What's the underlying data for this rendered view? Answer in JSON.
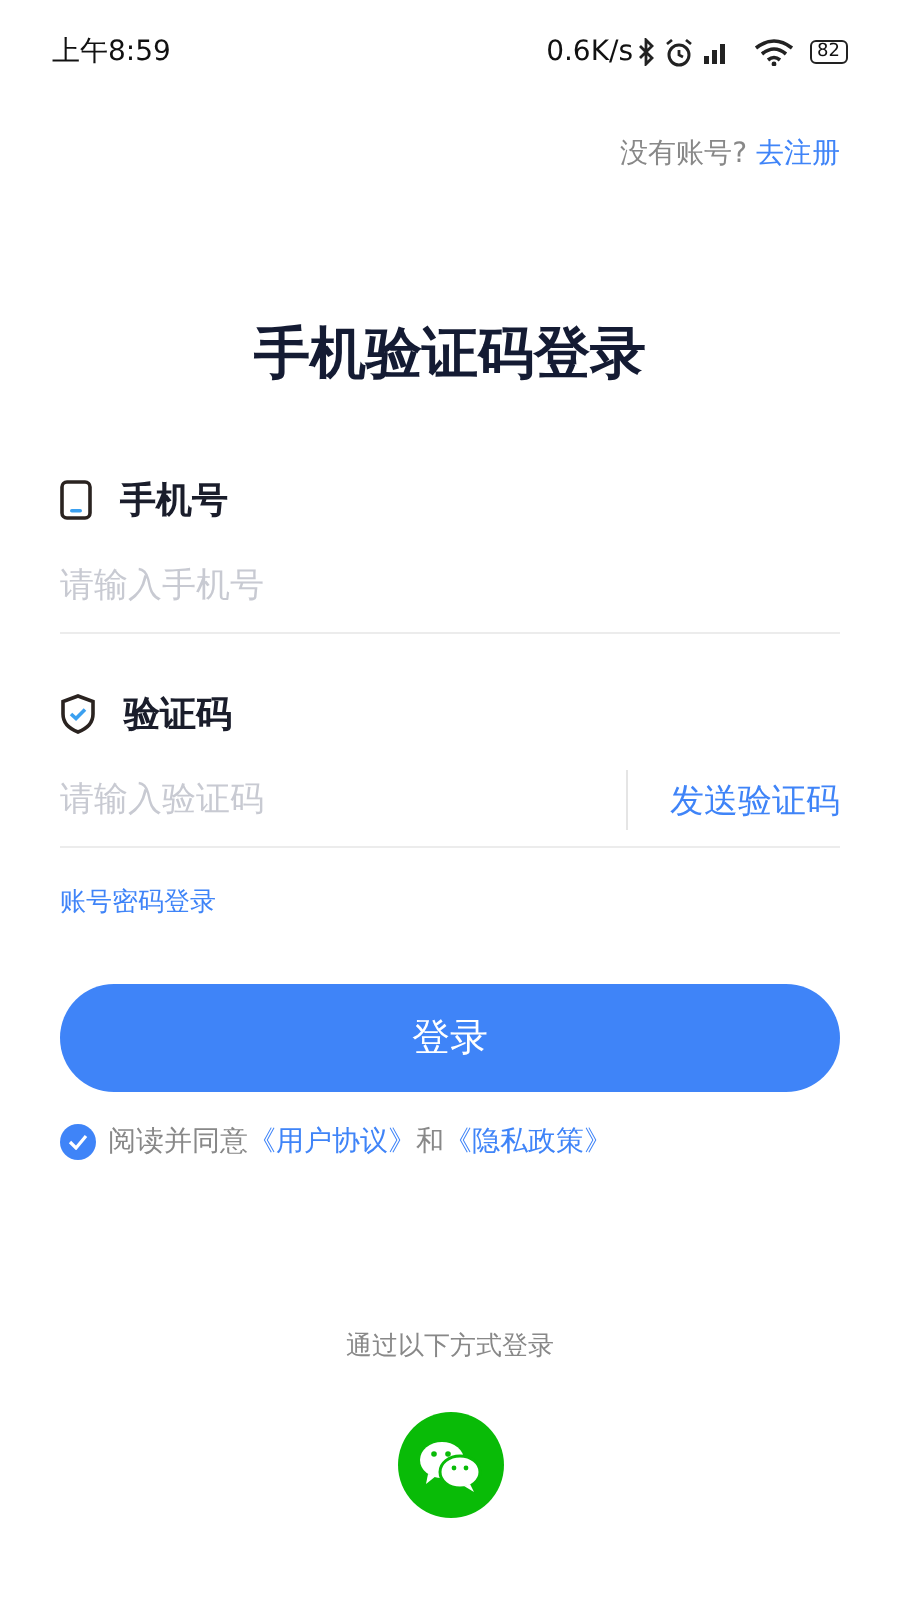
{
  "status_bar": {
    "time": "上午8:59",
    "net_speed": "0.6K/s",
    "battery": "82"
  },
  "register_prompt": {
    "text": "没有账号?",
    "link": "去注册"
  },
  "title": "手机验证码登录",
  "fields": [
    {
      "kind": "phone",
      "label": "手机号",
      "placeholder": "请输入手机号"
    },
    {
      "kind": "code",
      "label": "验证码",
      "placeholder": "请输入验证码",
      "action": "发送验证码"
    }
  ],
  "password_login_link": "账号密码登录",
  "login_button": "登录",
  "agreement": {
    "checked": true,
    "parts": [
      {
        "kind": "text",
        "text": "阅读并同意"
      },
      {
        "kind": "link",
        "text": "《用户协议》"
      },
      {
        "kind": "text",
        "text": "和"
      },
      {
        "kind": "link",
        "text": "《隐私政策》"
      }
    ]
  },
  "other_methods": {
    "label": "通过以下方式登录",
    "options": [
      {
        "kind": "wechat"
      }
    ]
  }
}
